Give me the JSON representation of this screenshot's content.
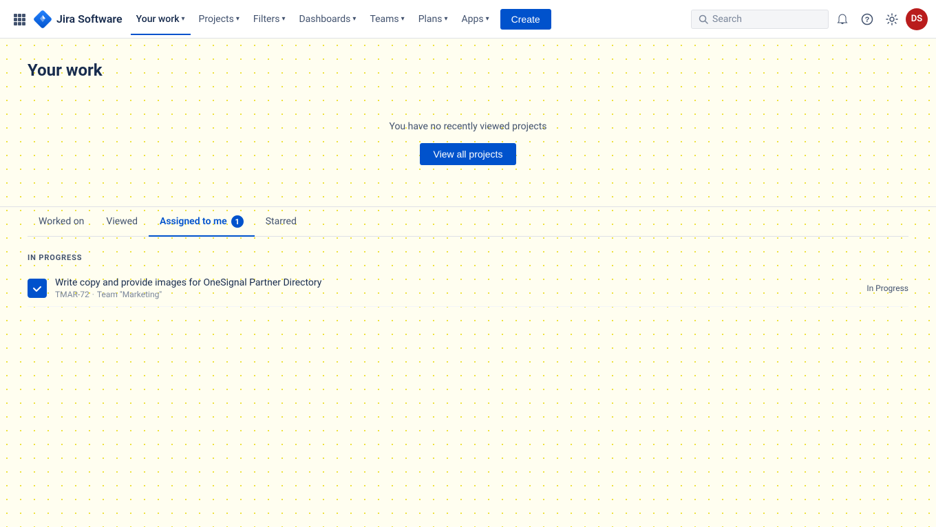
{
  "app": {
    "name": "Jira Software"
  },
  "navbar": {
    "brand": "Jira Software",
    "nav_items": [
      {
        "label": "Your work",
        "active": true,
        "has_dropdown": true
      },
      {
        "label": "Projects",
        "active": false,
        "has_dropdown": true
      },
      {
        "label": "Filters",
        "active": false,
        "has_dropdown": true
      },
      {
        "label": "Dashboards",
        "active": false,
        "has_dropdown": true
      },
      {
        "label": "Teams",
        "active": false,
        "has_dropdown": true
      },
      {
        "label": "Plans",
        "active": false,
        "has_dropdown": true
      },
      {
        "label": "Apps",
        "active": false,
        "has_dropdown": true
      }
    ],
    "create_label": "Create",
    "search_placeholder": "Search",
    "avatar_initials": "DS",
    "avatar_color": "#B91C1C"
  },
  "page": {
    "title": "Your work"
  },
  "projects_empty": {
    "message": "You have no recently viewed projects",
    "view_all_label": "View all projects"
  },
  "tabs": [
    {
      "label": "Worked on",
      "active": false,
      "badge": null
    },
    {
      "label": "Viewed",
      "active": false,
      "badge": null
    },
    {
      "label": "Assigned to me",
      "active": true,
      "badge": "1"
    },
    {
      "label": "Starred",
      "active": false,
      "badge": null
    }
  ],
  "in_progress_label": "IN PROGRESS",
  "tasks": [
    {
      "id": "TMAR-72",
      "title": "Write copy and provide images for OneSignal Partner Directory",
      "team": "Team \"Marketing\"",
      "status": "In Progress"
    }
  ],
  "colors": {
    "accent": "#0052CC",
    "text_primary": "#172B4D",
    "text_secondary": "#42526E",
    "text_muted": "#7A869A",
    "border": "#DFE1E6"
  }
}
